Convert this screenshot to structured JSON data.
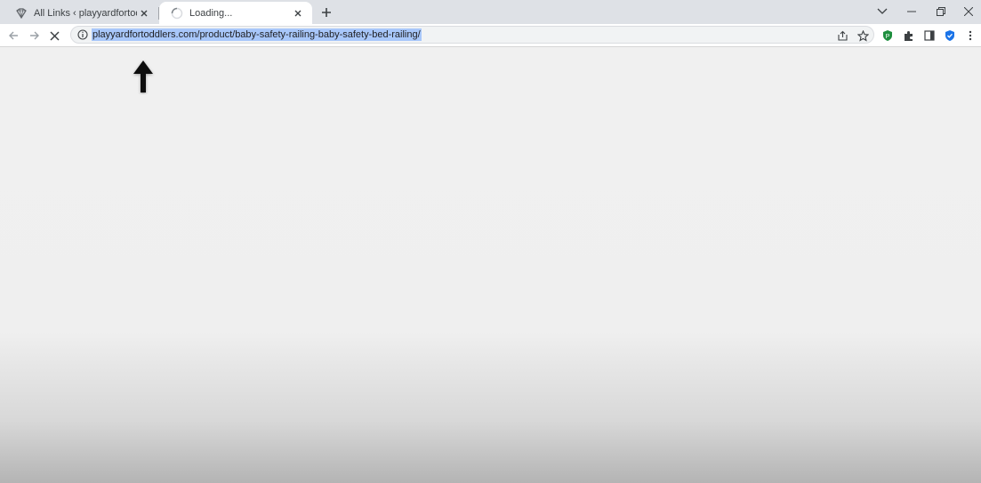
{
  "tabs": [
    {
      "title": "All Links ‹ playyardfortoddlers —",
      "favicon": "link-favicon-icon",
      "active": false
    },
    {
      "title": "Loading...",
      "favicon": "loading-spinner-icon",
      "active": true
    }
  ],
  "address_bar": {
    "url": "playyardfortoddlers.com/product/baby-safety-railing-baby-safety-bed-railing/",
    "selected": true
  },
  "icons": {
    "back": "back-arrow-icon",
    "forward": "forward-arrow-icon",
    "stop": "stop-loading-icon",
    "site_info": "info-icon",
    "share": "share-icon",
    "bookmark": "star-icon",
    "extensions": "puzzle-icon",
    "side_panel": "side-panel-icon",
    "menu": "kebab-menu-icon"
  },
  "colors": {
    "selection": "#a8c7fa",
    "tabstrip": "#dee1e6",
    "extension_green": "#1e8e3e",
    "extension_blue": "#1a73e8"
  }
}
